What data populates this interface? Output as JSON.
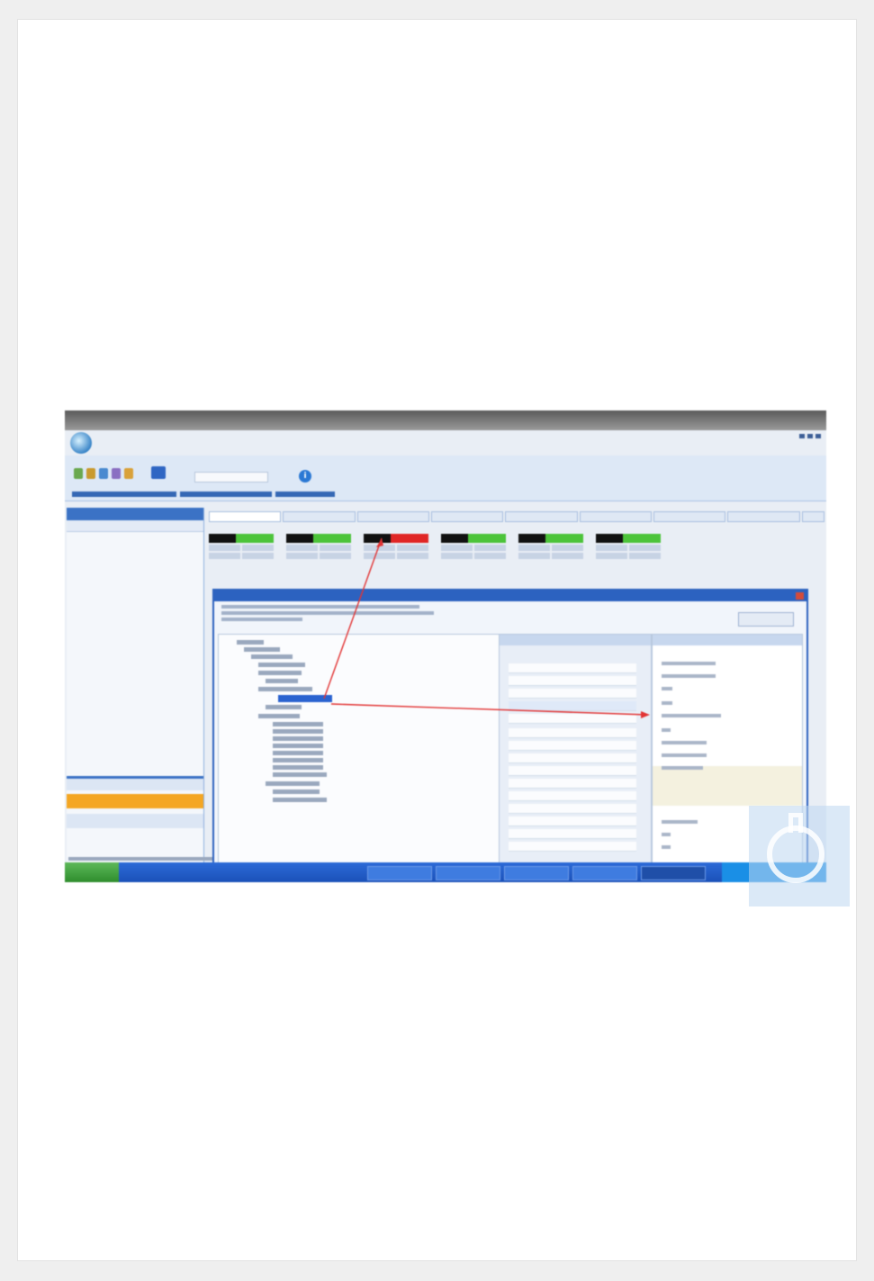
{
  "app": {
    "window_title": "",
    "menu": [
      "",
      "",
      "",
      "",
      ""
    ]
  },
  "sidebar": {
    "header": "",
    "nav_items": [
      "",
      "",
      ""
    ]
  },
  "tabs": [
    "",
    "",
    "",
    "",
    "",
    "",
    "",
    "",
    ""
  ],
  "sensors": [
    {
      "name": "",
      "status_color": "#4cc43a"
    },
    {
      "name": "",
      "status_color": "#4cc43a"
    },
    {
      "name": "",
      "status_color": "#e02626"
    },
    {
      "name": "",
      "status_color": "#4cc43a"
    },
    {
      "name": "",
      "status_color": "#4cc43a"
    },
    {
      "name": "",
      "status_color": "#4cc43a"
    }
  ],
  "dialog": {
    "title": "",
    "button_label": ""
  },
  "taskbar": {
    "start_label": ""
  },
  "colors": {
    "accent": "#2c62c0",
    "alarm_red": "#e02626",
    "ok_green": "#4cc43a",
    "nav_orange": "#f4a623"
  },
  "icons": [
    "app-logo-icon",
    "info-icon",
    "close-icon",
    "watermark-flask-icon"
  ]
}
